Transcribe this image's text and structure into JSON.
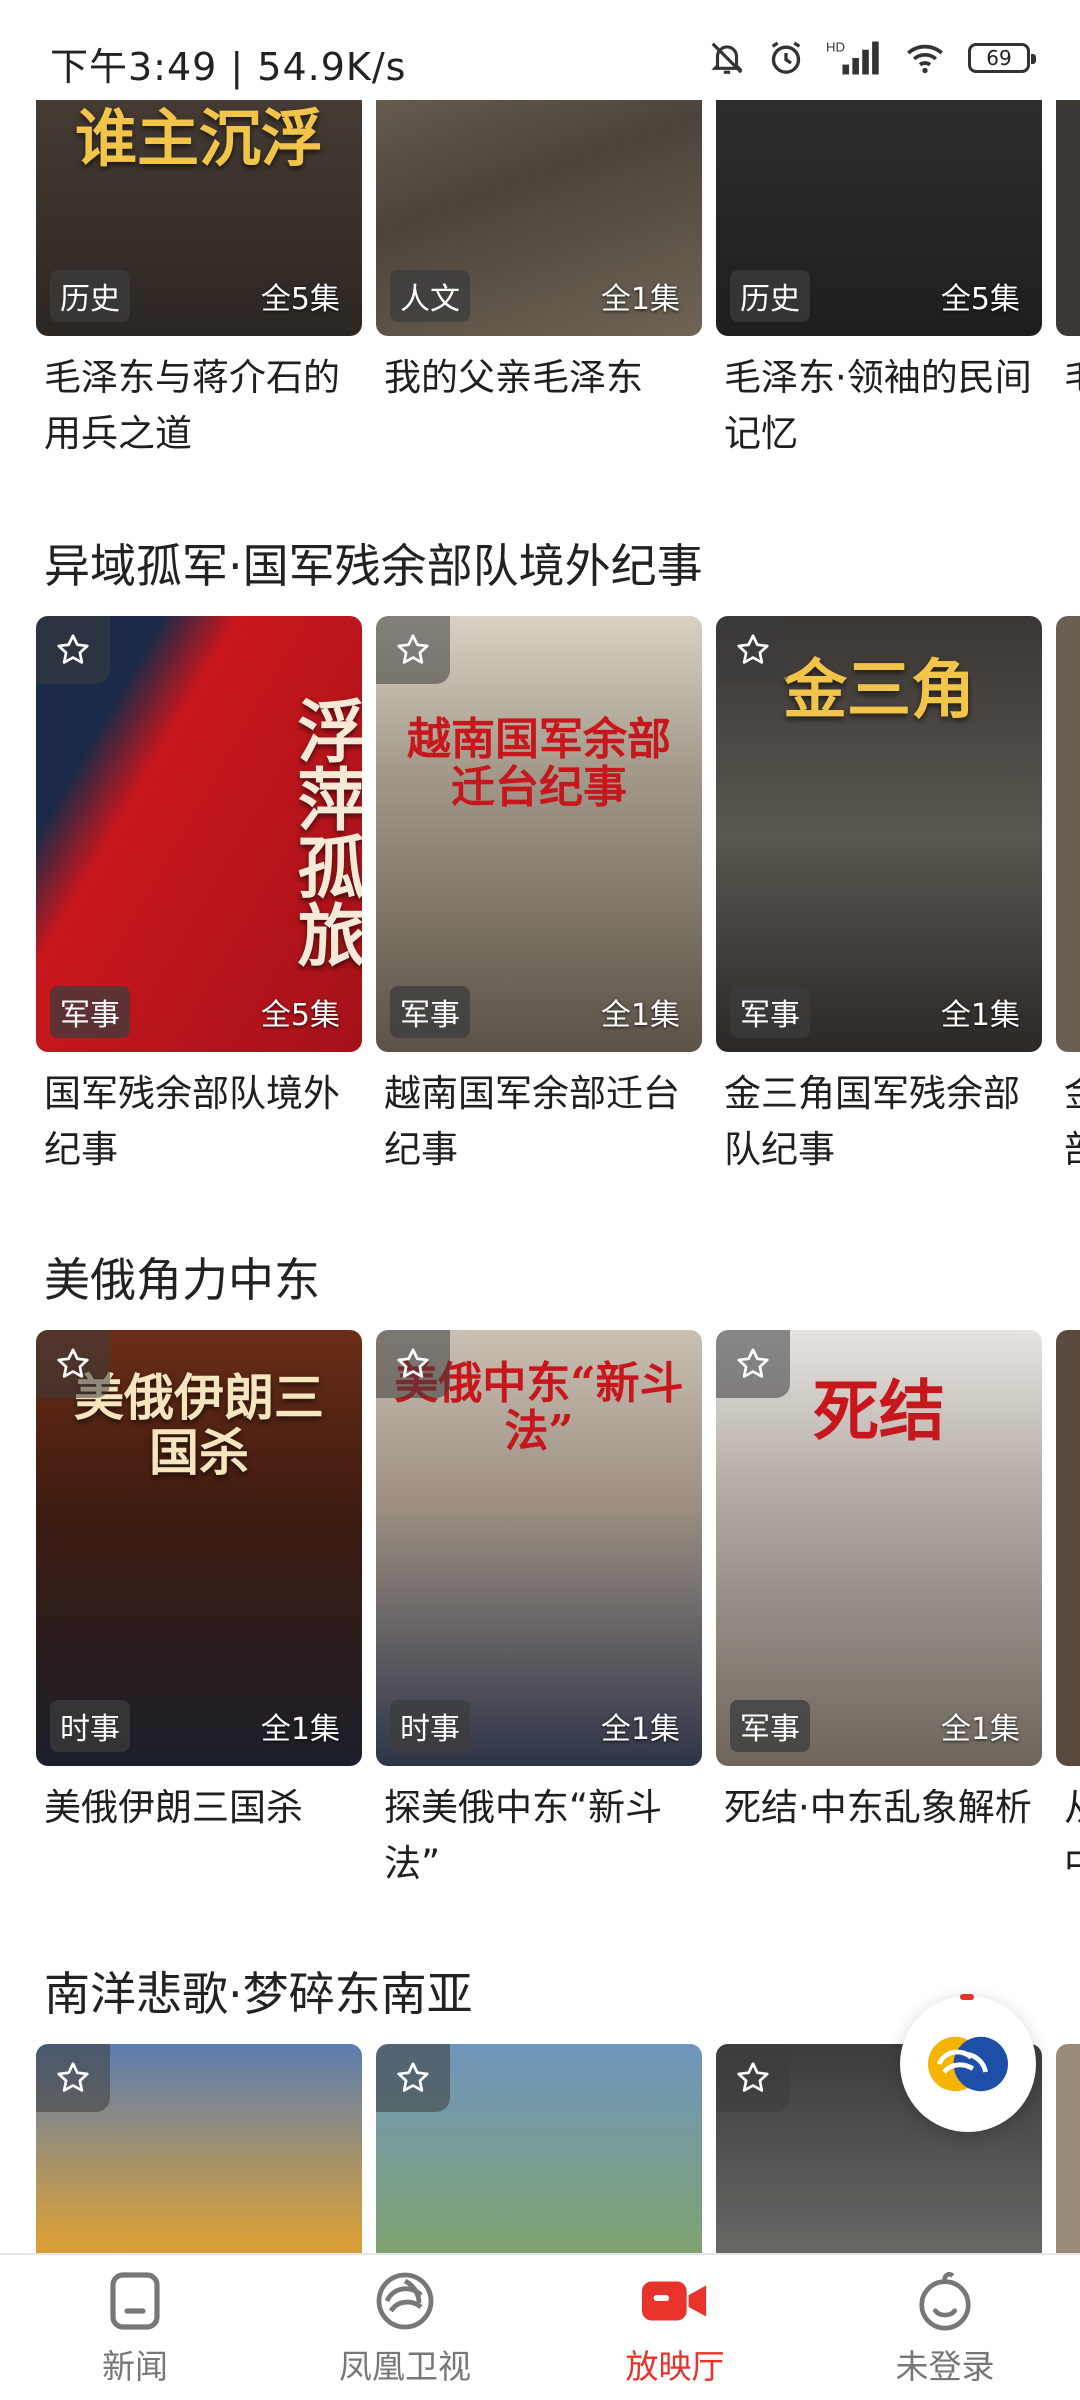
{
  "status_bar": {
    "time_speed": "下午3:49 | 54.9K/s",
    "battery": "69"
  },
  "section_top": {
    "items": [
      {
        "title": "毛泽东与蒋介石的用兵之道",
        "tag": "历史",
        "episodes": "全5集",
        "art_text": "谁主沉浮",
        "bg": "#3a3430"
      },
      {
        "title": "我的父亲毛泽东",
        "tag": "人文",
        "episodes": "全1集",
        "art_text": "",
        "bg": "#6c6358"
      },
      {
        "title": "毛泽东·领袖的民间记忆",
        "tag": "历史",
        "episodes": "全5集",
        "art_text": "",
        "bg": "#2e2d2c"
      },
      {
        "title": "毛",
        "tag": "",
        "episodes": "",
        "art_text": "",
        "bg": "#3b3733"
      }
    ]
  },
  "section_1": {
    "title": "异域孤军·国军残余部队境外纪事",
    "items": [
      {
        "title": "国军残余部队境外纪事",
        "tag": "军事",
        "episodes": "全5集",
        "art_text": "浮萍孤旅",
        "bg": "#b8141b"
      },
      {
        "title": "越南国军余部迁台纪事",
        "tag": "军事",
        "episodes": "全1集",
        "art_text": "越南国军余部迁台纪事",
        "bg": "#8b8275"
      },
      {
        "title": "金三角国军残余部队纪事",
        "tag": "军事",
        "episodes": "全1集",
        "art_text": "金三角",
        "bg": "#4d4945"
      },
      {
        "title": "金部",
        "tag": "",
        "episodes": "",
        "art_text": "",
        "bg": "#6a5f53"
      }
    ]
  },
  "section_2": {
    "title": "美俄角力中东",
    "items": [
      {
        "title": "美俄伊朗三国杀",
        "tag": "时事",
        "episodes": "全1集",
        "art_text": "美俄伊朗三国杀",
        "bg": "#4a2418"
      },
      {
        "title": "探美俄中东“新斗法”",
        "tag": "时事",
        "episodes": "全1集",
        "art_text": "美俄中东“新斗法”",
        "bg": "#9a8d80"
      },
      {
        "title": "死结·中东乱象解析",
        "tag": "军事",
        "episodes": "全1集",
        "art_text": "死结",
        "bg": "#7d7770"
      },
      {
        "title": "从中",
        "tag": "",
        "episodes": "",
        "art_text": "",
        "bg": "#5a4a40"
      }
    ]
  },
  "section_3": {
    "title": "南洋悲歌·梦碎东南亚",
    "items": [
      {
        "title": "",
        "tag": "",
        "episodes": "",
        "art_text": "",
        "bg": "#c57a2c"
      },
      {
        "title": "",
        "tag": "",
        "episodes": "",
        "art_text": "",
        "bg": "#6d8ea8"
      },
      {
        "title": "",
        "tag": "",
        "episodes": "",
        "art_text": "",
        "bg": "#4b4a48"
      },
      {
        "title": "",
        "tag": "",
        "episodes": "",
        "art_text": "",
        "bg": "#9b8a78"
      }
    ]
  },
  "bottom_nav": [
    {
      "label": "新闻",
      "icon": "news-icon"
    },
    {
      "label": "凤凰卫视",
      "icon": "phoenix-icon"
    },
    {
      "label": "放映厅",
      "icon": "video-camera-icon"
    },
    {
      "label": "未登录",
      "icon": "user-avatar-icon"
    }
  ],
  "colors": {
    "accent": "#e8332a",
    "nav_inactive": "#777777"
  }
}
